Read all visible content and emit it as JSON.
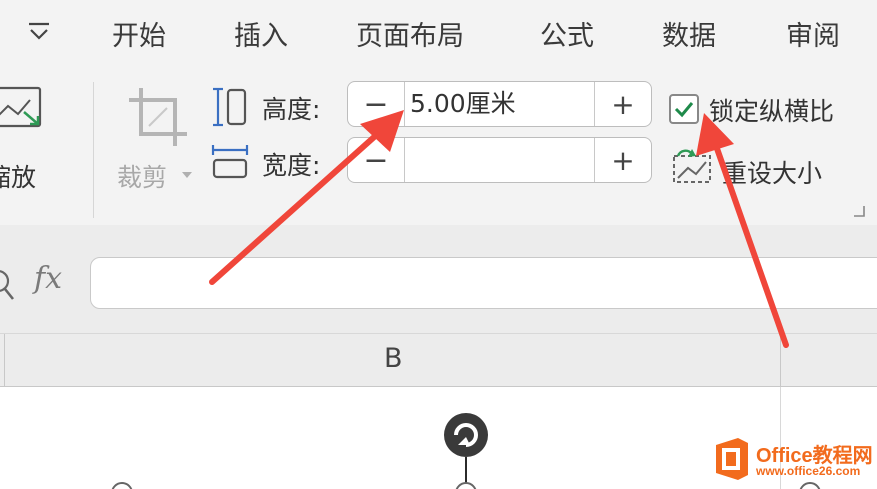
{
  "menu": {
    "dropdown_icon": "chevron-down-icon",
    "items": [
      "开始",
      "插入",
      "页面布局",
      "公式",
      "数据",
      "审阅"
    ]
  },
  "toolbar": {
    "scale_label": "缩放",
    "crop_label": "裁剪",
    "height_label": "高度:",
    "height_value": "5.00厘米",
    "width_label": "宽度:",
    "width_value": "",
    "minus_symbol": "−",
    "plus_symbol": "+",
    "lock_ratio_label": "锁定纵横比",
    "lock_ratio_checked": true,
    "reset_size_label": "重设大小"
  },
  "formula_bar": {
    "fx_label": "fx",
    "value": ""
  },
  "sheet": {
    "column_header": "B"
  },
  "watermark": {
    "brand": "Office教程网",
    "url": "www.office26.com"
  },
  "colors": {
    "arrow": "#f0463a",
    "check": "#1e8a4a",
    "watermark_orange": "#f26b1d"
  }
}
